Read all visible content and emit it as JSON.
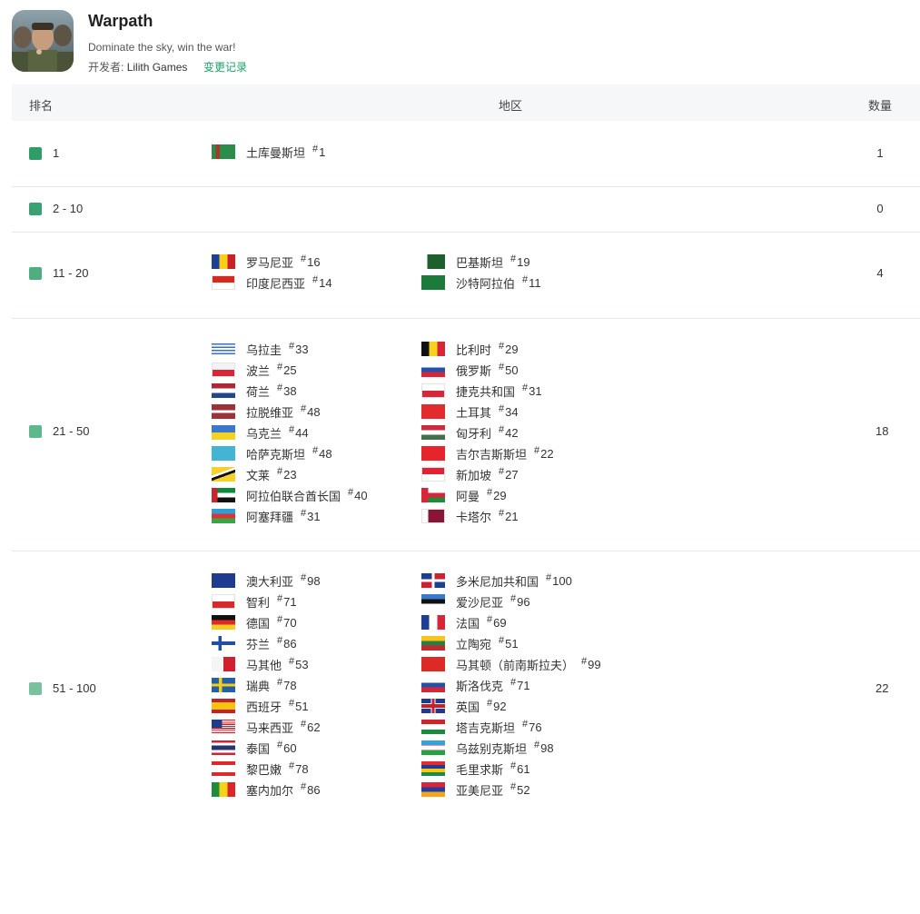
{
  "app": {
    "title": "Warpath",
    "subtitle": "Dominate the sky, win the war!",
    "developer_label": "开发者:",
    "developer_name": "Lilith Games",
    "changelog": "变更记录"
  },
  "table": {
    "headers": {
      "rank": "排名",
      "region": "地区",
      "count": "数量"
    },
    "rows": [
      {
        "range": "1",
        "count": "1",
        "color": "#2e9d67",
        "left": [
          {
            "name": "土库曼斯坦",
            "rank": "1",
            "flag": "tm"
          }
        ],
        "right": []
      },
      {
        "range": "2 - 10",
        "count": "0",
        "color": "#3aa173",
        "left": [],
        "right": []
      },
      {
        "range": "11 - 20",
        "count": "4",
        "color": "#4fae80",
        "left": [
          {
            "name": "罗马尼亚",
            "rank": "16",
            "flag": "ro"
          },
          {
            "name": "印度尼西亚",
            "rank": "14",
            "flag": "id"
          }
        ],
        "right": [
          {
            "name": "巴基斯坦",
            "rank": "19",
            "flag": "pk"
          },
          {
            "name": "沙特阿拉伯",
            "rank": "11",
            "flag": "sa"
          }
        ]
      },
      {
        "range": "21 - 50",
        "count": "18",
        "color": "#5fb78c",
        "left": [
          {
            "name": "乌拉圭",
            "rank": "33",
            "flag": "uy"
          },
          {
            "name": "波兰",
            "rank": "25",
            "flag": "pl"
          },
          {
            "name": "荷兰",
            "rank": "38",
            "flag": "nl"
          },
          {
            "name": "拉脱维亚",
            "rank": "48",
            "flag": "lv"
          },
          {
            "name": "乌克兰",
            "rank": "44",
            "flag": "ua"
          },
          {
            "name": "哈萨克斯坦",
            "rank": "48",
            "flag": "kz"
          },
          {
            "name": "文莱",
            "rank": "23",
            "flag": "bn"
          },
          {
            "name": "阿拉伯联合酋长国",
            "rank": "40",
            "flag": "ae"
          },
          {
            "name": "阿塞拜疆",
            "rank": "31",
            "flag": "az"
          }
        ],
        "right": [
          {
            "name": "比利时",
            "rank": "29",
            "flag": "be"
          },
          {
            "name": "俄罗斯",
            "rank": "50",
            "flag": "ru"
          },
          {
            "name": "捷克共和国",
            "rank": "31",
            "flag": "cz"
          },
          {
            "name": "土耳其",
            "rank": "34",
            "flag": "tr"
          },
          {
            "name": "匈牙利",
            "rank": "42",
            "flag": "hu"
          },
          {
            "name": "吉尔吉斯斯坦",
            "rank": "22",
            "flag": "kg"
          },
          {
            "name": "新加坡",
            "rank": "27",
            "flag": "sg"
          },
          {
            "name": "阿曼",
            "rank": "29",
            "flag": "om"
          },
          {
            "name": "卡塔尔",
            "rank": "21",
            "flag": "qa"
          }
        ]
      },
      {
        "range": "51 - 100",
        "count": "22",
        "color": "#77c29d",
        "left": [
          {
            "name": "澳大利亚",
            "rank": "98",
            "flag": "au"
          },
          {
            "name": "智利",
            "rank": "71",
            "flag": "cl"
          },
          {
            "name": "德国",
            "rank": "70",
            "flag": "de"
          },
          {
            "name": "芬兰",
            "rank": "86",
            "flag": "fi"
          },
          {
            "name": "马其他",
            "rank": "53",
            "flag": "mt"
          },
          {
            "name": "瑞典",
            "rank": "78",
            "flag": "se"
          },
          {
            "name": "西班牙",
            "rank": "51",
            "flag": "es"
          },
          {
            "name": "马来西亚",
            "rank": "62",
            "flag": "my"
          },
          {
            "name": "泰国",
            "rank": "60",
            "flag": "th"
          },
          {
            "name": "黎巴嫩",
            "rank": "78",
            "flag": "lb"
          },
          {
            "name": "塞内加尔",
            "rank": "86",
            "flag": "sn"
          }
        ],
        "right": [
          {
            "name": "多米尼加共和国",
            "rank": "100",
            "flag": "do"
          },
          {
            "name": "爱沙尼亚",
            "rank": "96",
            "flag": "ee"
          },
          {
            "name": "法国",
            "rank": "69",
            "flag": "fr"
          },
          {
            "name": "立陶宛",
            "rank": "51",
            "flag": "lt"
          },
          {
            "name": "马其顿（前南斯拉夫）",
            "rank": "99",
            "flag": "mk"
          },
          {
            "name": "斯洛伐克",
            "rank": "71",
            "flag": "sk"
          },
          {
            "name": "英国",
            "rank": "92",
            "flag": "gb"
          },
          {
            "name": "塔吉克斯坦",
            "rank": "76",
            "flag": "tj"
          },
          {
            "name": "乌兹别克斯坦",
            "rank": "98",
            "flag": "uz"
          },
          {
            "name": "毛里求斯",
            "rank": "61",
            "flag": "mu"
          },
          {
            "name": "亚美尼亚",
            "rank": "52",
            "flag": "am"
          }
        ]
      }
    ]
  }
}
